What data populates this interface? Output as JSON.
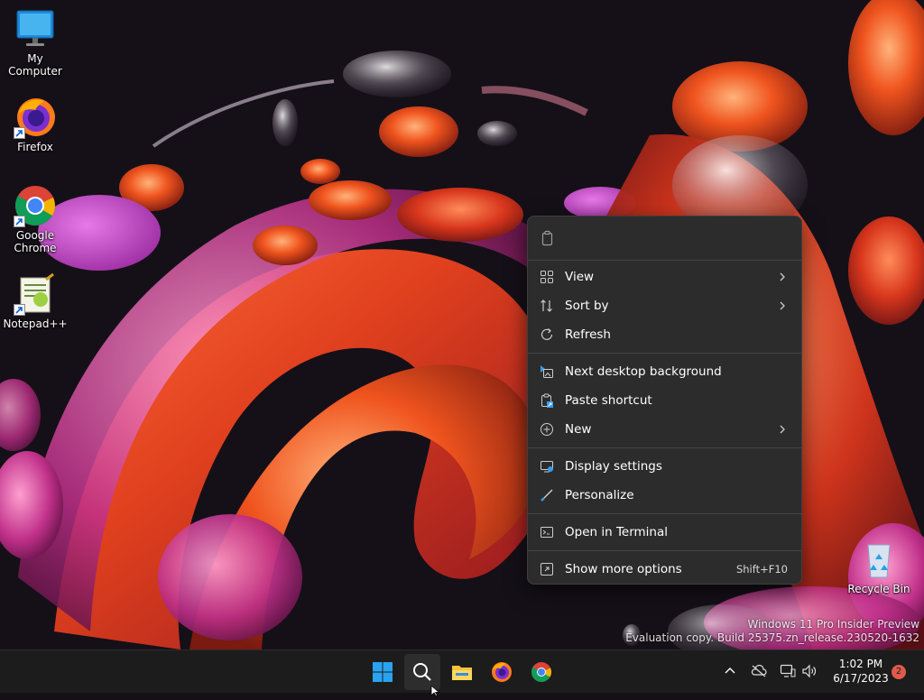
{
  "desktop": {
    "icons": [
      {
        "label": "My Computer"
      },
      {
        "label": "Firefox"
      },
      {
        "label_line1": "Google",
        "label_line2": "Chrome"
      },
      {
        "label": "Notepad++"
      },
      {
        "label": "Recycle Bin"
      }
    ]
  },
  "context_menu": {
    "items": [
      {
        "label": "View",
        "icon": "grid-view-icon",
        "has_submenu": true
      },
      {
        "label": "Sort by",
        "icon": "sort-arrows-icon",
        "has_submenu": true
      },
      {
        "label": "Refresh",
        "icon": "refresh-icon"
      },
      {
        "label": "Next desktop background",
        "icon": "next-background-icon"
      },
      {
        "label": "Paste shortcut",
        "icon": "paste-shortcut-icon"
      },
      {
        "label": "New",
        "icon": "new-plus-icon",
        "has_submenu": true
      },
      {
        "label": "Display settings",
        "icon": "display-settings-icon"
      },
      {
        "label": "Personalize",
        "icon": "brush-icon"
      },
      {
        "label": "Open in Terminal",
        "icon": "terminal-icon"
      },
      {
        "label": "Show more options",
        "icon": "show-more-icon",
        "shortcut": "Shift+F10"
      }
    ]
  },
  "watermark": {
    "line1": "Windows 11 Pro Insider Preview",
    "line2": "Evaluation copy. Build 25375.zn_release.230520-1632"
  },
  "taskbar": {
    "apps": [
      "start-button",
      "search-button",
      "file-explorer",
      "firefox",
      "chrome"
    ],
    "clock": {
      "time": "1:02 PM",
      "date": "6/17/2023"
    },
    "notification_count": "2"
  },
  "colors": {
    "menu_bg": "#2c2c2c",
    "taskbar_bg": "#1c1c1c",
    "accent_blue": "#0078d4",
    "badge": "#e05a4b"
  }
}
